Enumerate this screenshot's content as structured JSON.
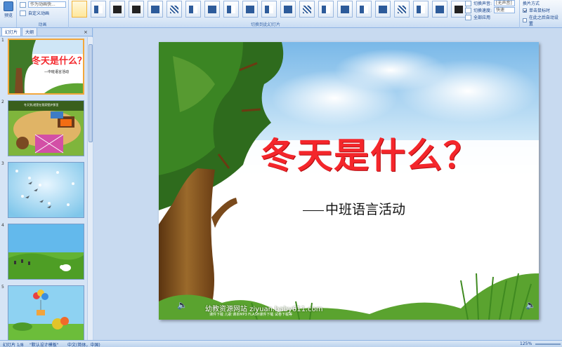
{
  "ribbon": {
    "preview_label": "预览",
    "sound_placeholder": "作为动画快...",
    "custom_label": "自定义动画",
    "anim_group_label": "动画",
    "transition_group_label": "切换到此幻灯片",
    "transition_sound_label": "切换声音:",
    "transition_sound_value": "[无声音]",
    "transition_speed_label": "切换速度:",
    "transition_speed_value": "快速",
    "apply_all_label": "全部应用",
    "advance_label": "换片方式",
    "on_click_label": "单击鼠标时",
    "after_label": "在此之后自动设置"
  },
  "panel": {
    "tab_slides": "幻灯片",
    "tab_outline": "大纲",
    "close": "×",
    "slides": [
      {
        "num": "1"
      },
      {
        "num": "2",
        "caption": "冬天到,就是在我家壁炉那里"
      },
      {
        "num": "3"
      },
      {
        "num": "4"
      },
      {
        "num": "5"
      }
    ]
  },
  "slide": {
    "title": "冬天是什么？",
    "subtitle": "中班语言活动",
    "footer_site": "幼教资源网站 ziyuan.baby611.com",
    "footer_sub": "课件下载  儿歌  课本MP3  FLASH课件下载  试卷下载等"
  },
  "status": {
    "slide_info": "幻灯片 1/8",
    "theme": "\"默认设计模板\"",
    "language": "中文(简体，中国)",
    "zoom": "125%"
  },
  "colors": {
    "title_red": "#f4262b",
    "ribbon_blue": "#15428b",
    "panel_bg": "#d6e4f5"
  }
}
